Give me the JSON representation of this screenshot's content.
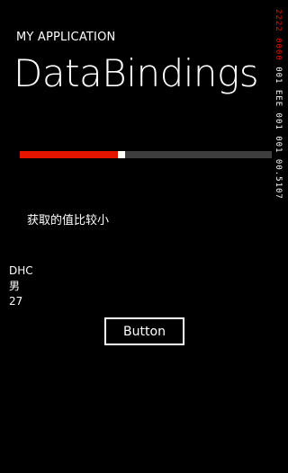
{
  "header": {
    "app_title": "MY APPLICATION",
    "page_title": "DataBindings"
  },
  "slider": {
    "value_fraction": 0.39,
    "fill_color": "#e51400",
    "track_color": "#3d3d3d",
    "thumb_color": "#ffffff"
  },
  "compare_text": "获取的值比较小",
  "person": {
    "name": "DHC",
    "gender": "男",
    "age": "27"
  },
  "button": {
    "label": "Button"
  },
  "status_bar": {
    "red_part": "2222 0000",
    "white_part": "001 EEE 001 001 00.5107"
  }
}
